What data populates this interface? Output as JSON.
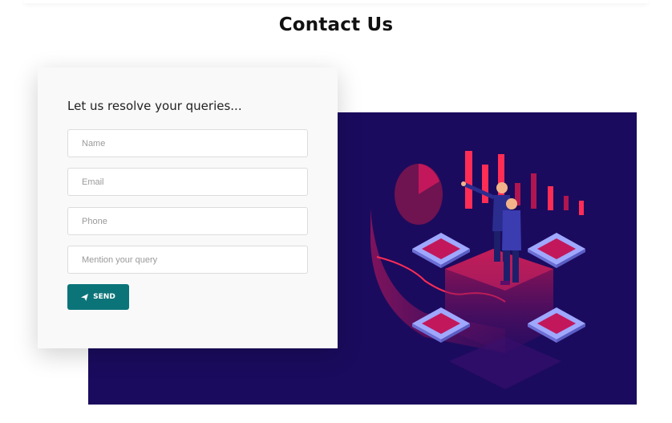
{
  "page": {
    "title": "Contact Us"
  },
  "form": {
    "heading": "Let us resolve your queries...",
    "fields": {
      "name_placeholder": "Name",
      "email_placeholder": "Email",
      "phone_placeholder": "Phone",
      "query_placeholder": "Mention your query"
    },
    "send_label": "SEND",
    "send_icon": "paper-plane-icon"
  },
  "hero": {
    "icon": "analytics-illustration"
  },
  "colors": {
    "accent": "#0b7479",
    "hero_background": "#1b0b5e",
    "highlight": "#ff2d55"
  }
}
